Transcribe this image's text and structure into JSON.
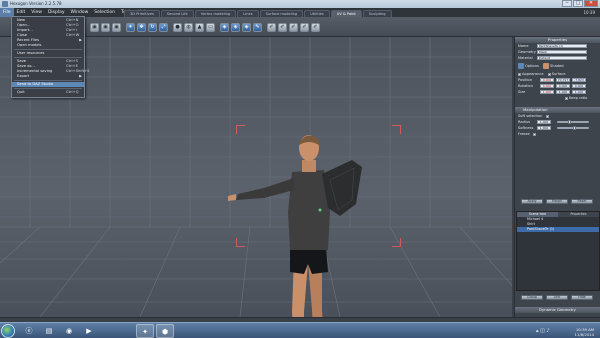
{
  "window": {
    "title": "Hexagon Version 2.2.5.78"
  },
  "window_controls": {
    "minimize": "‒",
    "maximize": "□",
    "close": "✕"
  },
  "menubar": {
    "items": [
      "File",
      "Edit",
      "View",
      "Display",
      "Window",
      "Selection",
      "Tools",
      "Help"
    ],
    "active": "File",
    "clock": "10:39"
  },
  "tabs": [
    "3D Primitives",
    "Second Life",
    "Vertex modeling",
    "Lines",
    "Surface modeling",
    "Utilities",
    "UV & Paint",
    "Sculpting"
  ],
  "active_tab": "UV & Paint",
  "file_menu": {
    "items": [
      {
        "label": "New",
        "shortcut": "Ctrl+N"
      },
      {
        "label": "Open...",
        "shortcut": "Ctrl+O"
      },
      {
        "label": "Import...",
        "shortcut": "Ctrl+I"
      },
      {
        "label": "Close",
        "shortcut": "Ctrl+W"
      },
      {
        "label": "Recent Files",
        "shortcut": ""
      },
      {
        "label": "Open models",
        "shortcut": ""
      },
      {
        "label": "User resources",
        "shortcut": ""
      },
      {
        "label": "Save",
        "shortcut": "Ctrl+S"
      },
      {
        "label": "Save as...",
        "shortcut": "Ctrl+E"
      },
      {
        "label": "Incremental saving",
        "shortcut": "Ctrl+Shift+S"
      },
      {
        "label": "Export",
        "shortcut": ""
      },
      {
        "label": "Send to DAZ Studio",
        "shortcut": ""
      },
      {
        "label": "Quit",
        "shortcut": "Ctrl+Q"
      }
    ],
    "highlighted": "Send to DAZ Studio"
  },
  "properties_panel": {
    "header": "Properties",
    "name_label": "Name",
    "name_value": "PantShaveTe (1)",
    "geometry_label": "Geometry",
    "geometry_value": "Mesh",
    "material_label": "Material",
    "material_value": "Default",
    "display_options": [
      "Options",
      "Shaded",
      "Textured"
    ],
    "quick_labels": [
      "Appearance",
      "Surface"
    ],
    "position": {
      "label": "Position",
      "x": "0.000",
      "y": "70.797",
      "z": "-7.823"
    },
    "rotation": {
      "label": "Rotation",
      "x": "0.000",
      "y": "0.000",
      "z": "0.000"
    },
    "size": {
      "label": "Size",
      "x": "1.000",
      "y": "1.000",
      "z": "1.000"
    },
    "keep_ratio": "Keep ratio"
  },
  "manipulation": {
    "header": "Manipulation",
    "soft_selection": "Soft selection",
    "radius_label": "Radius",
    "radius_value": "1.000",
    "radius_fraction": 0.35,
    "softness_label": "Softness",
    "softness_value": "1.000",
    "softness_fraction": 0.5,
    "freeze_label": "Freeze"
  },
  "mid_buttons": [
    "Apply",
    "Morph",
    "Reset"
  ],
  "scene_panel": {
    "tabs": [
      "Scene tree",
      "Properties"
    ],
    "items": [
      "Michael 4",
      "Shirt",
      "PantShaveTe (1)"
    ],
    "selected": "PantShaveTe (1)"
  },
  "scene_buttons": [
    "Group",
    "Link",
    "Hide"
  ],
  "dynamic_geometry_label": "Dynamic Geometry",
  "taskbar": {
    "apps": [
      "IE",
      "Explorer",
      "Chrome",
      "Media",
      "DAZ",
      "Hexagon"
    ],
    "time": "10:39 AM",
    "date": "11/8/2014"
  },
  "colors": {
    "accent": "#5d87b6",
    "viewport": "#555c66",
    "selection_corners": "#d15a5a",
    "panel": "#3e444c"
  }
}
